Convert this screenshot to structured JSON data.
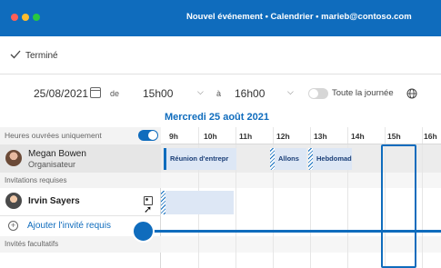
{
  "window": {
    "title": "Nouvel événement • Calendrier • marieb@contoso.com",
    "colors": {
      "accent": "#0f6cbd",
      "close": "#ff5f57",
      "minimize": "#febc2e",
      "zoom": "#28c840"
    }
  },
  "toolbar": {
    "done_label": "Terminé",
    "done_icon": "checkmark-icon"
  },
  "date_row": {
    "start_date": "25/08/2021",
    "from_label": "de",
    "start_time": "15h00",
    "to_label": "à",
    "end_time": "16h00",
    "all_day_label": "Toute la journée",
    "all_day_on": false
  },
  "scheduler": {
    "date_heading": "Mercredi 25 août 2021",
    "work_hours_label": "Heures ouvrées uniquement",
    "work_hours_on": true,
    "hours": [
      "9h",
      "10h",
      "11h",
      "12h",
      "13h",
      "14h",
      "15h",
      "16h"
    ],
    "organizer": {
      "name": "Megan Bowen",
      "role": "Organisateur"
    },
    "required_header": "Invitations requises",
    "required": [
      {
        "name": "Irvin Sayers"
      }
    ],
    "add_required_label": "Ajouter l'invité requis",
    "optional_header": "Invités facultatifs",
    "events": [
      {
        "title": "Réunion d'entrepr"
      },
      {
        "title": "Allons"
      },
      {
        "title": "Hebdomadai"
      }
    ]
  }
}
